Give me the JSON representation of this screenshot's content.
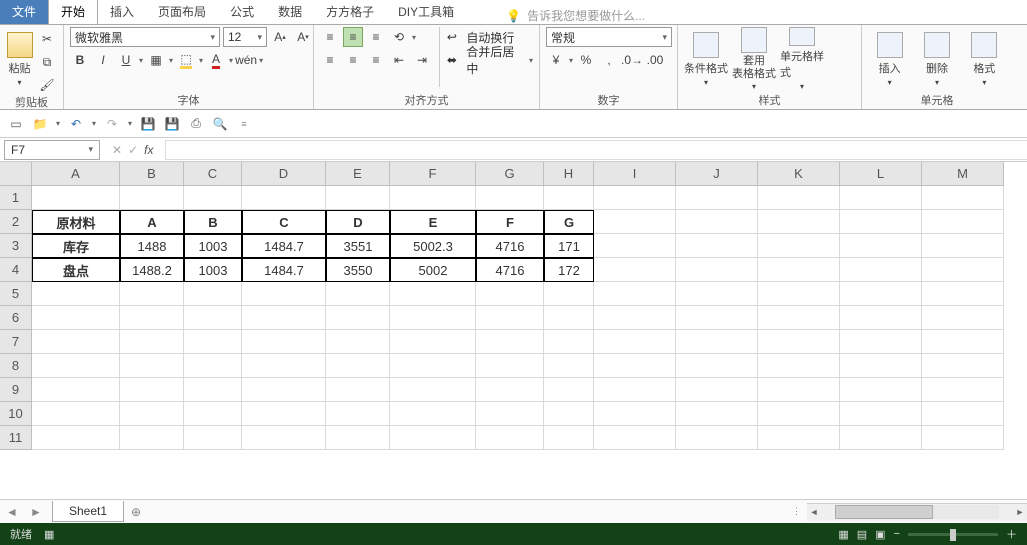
{
  "tabs": {
    "file": "文件",
    "start": "开始",
    "insert": "插入",
    "layout": "页面布局",
    "formula": "公式",
    "data": "数据",
    "ffgz": "方方格子",
    "diy": "DIY工具箱",
    "tellme": "告诉我您想要做什么..."
  },
  "ribbon": {
    "clipboard": {
      "paste": "粘贴",
      "label": "剪贴板"
    },
    "font": {
      "name": "微软雅黑",
      "size": "12",
      "label": "字体"
    },
    "align": {
      "wrap": "自动换行",
      "merge": "合并后居中",
      "label": "对齐方式"
    },
    "number": {
      "format": "常规",
      "label": "数字"
    },
    "styles": {
      "cond": "条件格式",
      "table": "套用\n表格格式",
      "cell": "单元格样式",
      "label": "样式"
    },
    "cells": {
      "insert": "插入",
      "delete": "删除",
      "format": "格式",
      "label": "单元格"
    }
  },
  "namebox": "F7",
  "columns": [
    "A",
    "B",
    "C",
    "D",
    "E",
    "F",
    "G",
    "H",
    "I",
    "J",
    "K",
    "L",
    "M"
  ],
  "rows": [
    "1",
    "2",
    "3",
    "4",
    "5",
    "6",
    "7",
    "8",
    "9",
    "10",
    "11"
  ],
  "tabledata": {
    "r2": [
      "原材料",
      "A",
      "B",
      "C",
      "D",
      "E",
      "F",
      "G"
    ],
    "r3": [
      "库存",
      "1488",
      "1003",
      "1484.7",
      "3551",
      "5002.3",
      "4716",
      "171"
    ],
    "r4": [
      "盘点",
      "1488.2",
      "1003",
      "1484.7",
      "3550",
      "5002",
      "4716",
      "172"
    ]
  },
  "sheet": {
    "name": "Sheet1"
  },
  "status": {
    "ready": "就绪"
  }
}
